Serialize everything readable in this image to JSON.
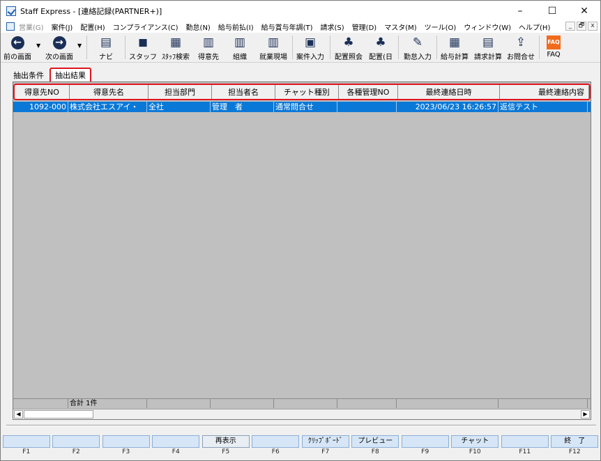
{
  "window": {
    "title": "Staff Express - [連絡記録(PARTNER+)]",
    "controls": [
      "–",
      "☐",
      "✕"
    ]
  },
  "menubar": {
    "items": [
      {
        "label": "営業(G)",
        "disabled": true
      },
      {
        "label": "案件(J)"
      },
      {
        "label": "配置(H)"
      },
      {
        "label": "コンプライアンス(C)"
      },
      {
        "label": "勤怠(N)"
      },
      {
        "label": "給与前払(I)"
      },
      {
        "label": "給与賞与年調(T)"
      },
      {
        "label": "請求(S)"
      },
      {
        "label": "管理(D)"
      },
      {
        "label": "マスタ(M)"
      },
      {
        "label": "ツール(O)"
      },
      {
        "label": "ウィンドウ(W)"
      },
      {
        "label": "ヘルプ(H)"
      }
    ],
    "mdi_controls": [
      "_",
      "🗗",
      "x"
    ]
  },
  "toolbar": {
    "prev": "前の画面",
    "next": "次の画面",
    "navi": "ナビ",
    "staff": "スタッフ",
    "staff_search": "ｽﾀｯﾌ検索",
    "client": "得意先",
    "org": "組織",
    "site": "就業現場",
    "case_input": "案件入力",
    "assign_lookup": "配置照会",
    "assign_day": "配置(日",
    "attendance_input": "勤怠入力",
    "payroll_calc": "給与計算",
    "billing_calc": "請求計算",
    "inquiry": "お問合せ",
    "faq": "FAQ",
    "faq_icon_text": "FAQ"
  },
  "tabs": [
    {
      "label": "抽出条件",
      "active": false
    },
    {
      "label": "抽出結果",
      "active": true
    }
  ],
  "grid": {
    "columns": [
      "得意先NO",
      "得意先名",
      "担当部門",
      "担当者名",
      "チャット種別",
      "各種管理NO",
      "最終連絡日時",
      "最終連絡内容"
    ],
    "rows": [
      [
        "1092-000",
        "株式会社エスアイ・",
        "全社",
        "管理　者",
        "通常問合せ",
        "",
        "2023/06/23 16:26:57",
        "返信テスト"
      ]
    ],
    "footer": [
      "",
      "合計  1件",
      "",
      "",
      "",
      "",
      "",
      ""
    ]
  },
  "fkeys": [
    {
      "key": "F1",
      "label": ""
    },
    {
      "key": "F2",
      "label": ""
    },
    {
      "key": "F3",
      "label": ""
    },
    {
      "key": "F4",
      "label": ""
    },
    {
      "key": "F5",
      "label": "再表示"
    },
    {
      "key": "F6",
      "label": ""
    },
    {
      "key": "F7",
      "label": "ｸﾘｯﾌﾟﾎﾞｰﾄﾞ"
    },
    {
      "key": "F8",
      "label": "プレビュー"
    },
    {
      "key": "F9",
      "label": ""
    },
    {
      "key": "F10",
      "label": "チャット"
    },
    {
      "key": "F11",
      "label": ""
    },
    {
      "key": "F12",
      "label": "終　了"
    }
  ],
  "colors": {
    "selection": "#0a78d7",
    "highlight_border": "#e0141e",
    "faq_orange": "#f26a1b",
    "icon_navy": "#1a2f57"
  }
}
